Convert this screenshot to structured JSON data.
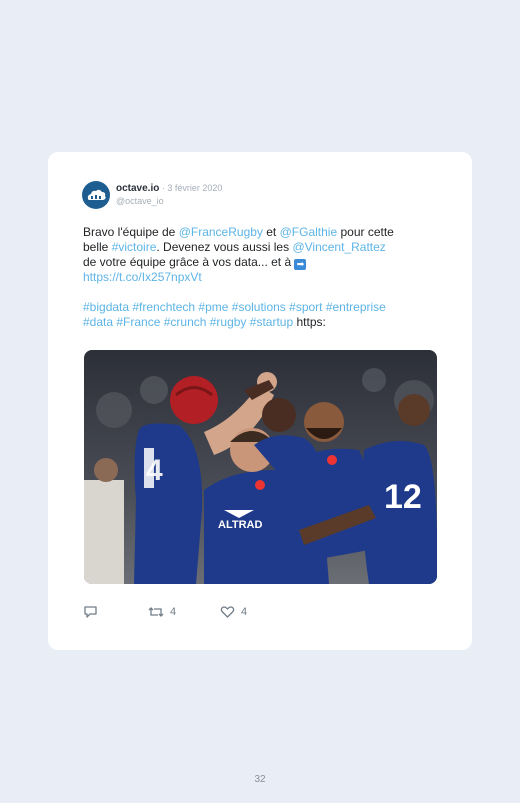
{
  "tweet": {
    "author_name": "octave.io",
    "separator": " · ",
    "date": "3 février 2020",
    "handle": "@octave_io",
    "body": {
      "l1_text_a": "Bravo l'équipe de ",
      "l1_link_a": "@FranceRugby",
      "l1_text_b": " et ",
      "l1_link_b": "@FGalthie",
      "l1_text_c": " pour cette",
      "l2_text_a": "belle ",
      "l2_link_a": "#victoire",
      "l2_text_b": ". Devenez vous aussi les ",
      "l2_link_b": "@Vincent_Rattez",
      "l3_text": "de votre équipe grâce à vos data... et à ",
      "l3_emoji": "➡",
      "l4_link": "https://t.co/Ix257npxVt",
      "l5_tags": "#bigdata #frenchtech #pme #solutions #sport #entreprise",
      "l6_tags": "#data #France #crunch #rugby #startup",
      "l6_text": " https:"
    },
    "photo": {
      "jersey_a_number": "4",
      "jersey_b_number": "12",
      "sponsor": "ALTRAD"
    },
    "actions": {
      "retweet_count": "4",
      "like_count": "4"
    }
  },
  "page_number": "32",
  "colors": {
    "background": "#e9edf6",
    "card": "#ffffff",
    "link": "#5db4e6",
    "jersey": "#1f3a8a"
  }
}
